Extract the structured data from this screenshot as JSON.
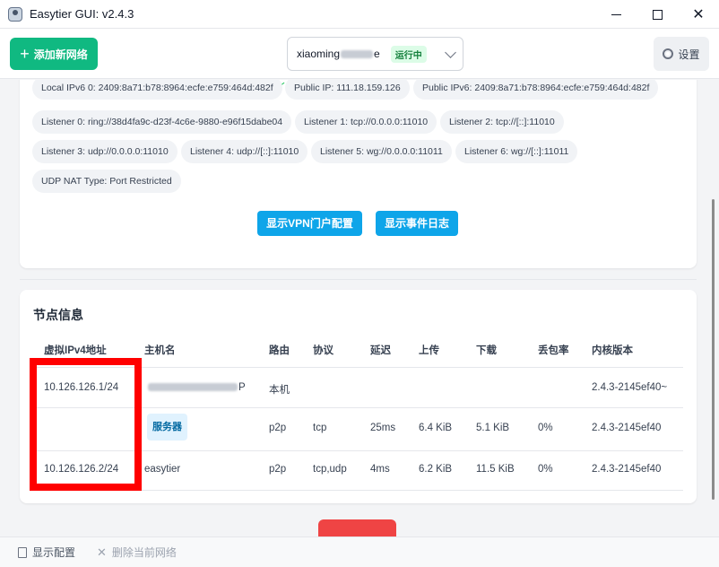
{
  "window": {
    "title": "Easytier GUI: v2.4.3",
    "controls": {
      "minimize": "",
      "maximize": "",
      "close": "✕"
    }
  },
  "toolbar": {
    "add_network_label": "添加新网络",
    "add_icon": "+",
    "network_name_prefix": "xiaoming",
    "network_name_suffix": "e",
    "status_tag": "运行中",
    "settings_label": "设置"
  },
  "node_info": {
    "chips": [
      "Local IPv6 0: 2409:8a71:b78:8964:ecfe:e759:464d:482f",
      "Public IP: 111.18.159.126",
      "Public IPv6: 2409:8a71:b78:8964:ecfe:e759:464d:482f",
      "Listener 0: ring://38d4fa9c-d23f-4c6e-9880-e96f15dabe04",
      "Listener 1: tcp://0.0.0.0:11010",
      "Listener 2: tcp://[::]:11010",
      "Listener 3: udp://0.0.0.0:11010",
      "Listener 4: udp://[::]:11010",
      "Listener 5: wg://0.0.0.0:11011",
      "Listener 6: wg://[::]:11011",
      "UDP NAT Type: Port Restricted"
    ],
    "buttons": {
      "vpn_portal": "显示VPN门户配置",
      "event_log": "显示事件日志"
    }
  },
  "peers": {
    "title": "节点信息",
    "columns": [
      "虚拟IPv4地址",
      "主机名",
      "路由",
      "协议",
      "延迟",
      "上传",
      "下载",
      "丢包率",
      "内核版本"
    ],
    "rows": [
      {
        "ip": "10.126.126.1/24",
        "host_prefix": "",
        "host_suffix": "P",
        "route": "本机",
        "proto": "",
        "latency": "",
        "up": "",
        "down": "",
        "loss": "",
        "version": "2.4.3-2145ef40~"
      },
      {
        "ip": "",
        "host_tag": "服务器",
        "route": "p2p",
        "proto": "tcp",
        "latency": "25ms",
        "up": "6.4 KiB",
        "down": "5.1 KiB",
        "loss": "0%",
        "version": "2.4.3-2145ef40"
      },
      {
        "ip": "10.126.126.2/24",
        "host": "easytier",
        "route": "p2p",
        "proto": "tcp,udp",
        "latency": "4ms",
        "up": "6.2 KiB",
        "down": "11.5 KiB",
        "loss": "0%",
        "version": "2.4.3-2145ef40"
      }
    ]
  },
  "bottom": {
    "show_config": "显示配置",
    "delete_network": "删除当前网络"
  },
  "colors": {
    "primary_green": "#10b981",
    "button_blue": "#0ea5e9",
    "highlight_red": "#ff0000",
    "danger_red": "#ef4444"
  }
}
